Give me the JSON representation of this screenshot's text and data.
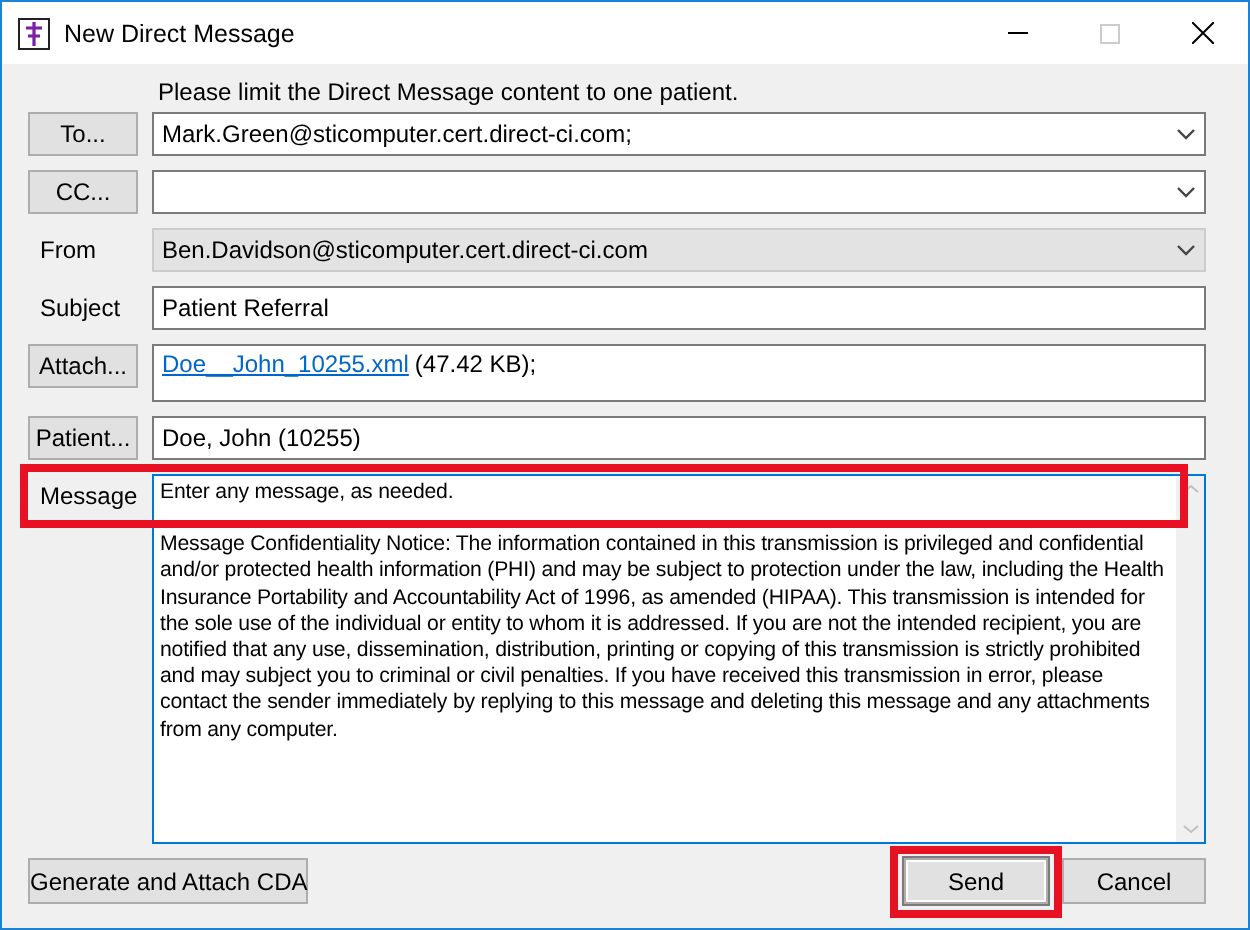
{
  "window": {
    "title": "New Direct Message"
  },
  "notice": "Please limit the Direct Message content to one patient.",
  "rows": [
    {
      "kind": "button",
      "label": "To...",
      "field": {
        "kind": "combo",
        "value": "Mark.Green@sticomputer.cert.direct-ci.com;",
        "disabled": false
      }
    },
    {
      "kind": "button",
      "label": "CC...",
      "field": {
        "kind": "combo",
        "disabled": false
      }
    },
    {
      "kind": "label",
      "label": "From",
      "field": {
        "kind": "combo",
        "value": "Ben.Davidson@sticomputer.cert.direct-ci.com",
        "disabled": true
      }
    },
    {
      "kind": "label",
      "label": "Subject",
      "field": {
        "kind": "text",
        "value": "Patient Referral"
      }
    },
    {
      "kind": "button",
      "label": "Attach...",
      "field": {
        "kind": "attachment",
        "link": "Doe__John_10255.xml",
        "size": "(47.42 KB);"
      }
    },
    {
      "kind": "button",
      "label": "Patient...",
      "field": {
        "kind": "text",
        "value": "Doe, John (10255)"
      }
    },
    {
      "kind": "label",
      "label": "Message",
      "highlighted": true,
      "field": {
        "kind": "message",
        "value": "Enter any message, as needed.",
        "notice": "Message Confidentiality Notice: The information contained in this transmission is privileged and confidential and/or protected health information (PHI) and may be subject to protection under the law, including the Health Insurance Portability and Accountability Act of 1996, as amended (HIPAA). This transmission is intended for the sole use of the individual or entity to whom it is addressed. If you are not the intended recipient, you are notified that any use, dissemination, distribution, printing or copying of this transmission is strictly prohibited and may subject you to criminal or civil penalties. If you have received this transmission in error, please contact the sender immediately by replying to this message and deleting this message and any attachments from any computer."
      }
    }
  ],
  "footer": {
    "generate": "Generate and Attach CDA",
    "buttons": [
      {
        "label": "Send",
        "highlighted": true
      },
      {
        "label": "Cancel",
        "highlighted": false
      }
    ]
  }
}
